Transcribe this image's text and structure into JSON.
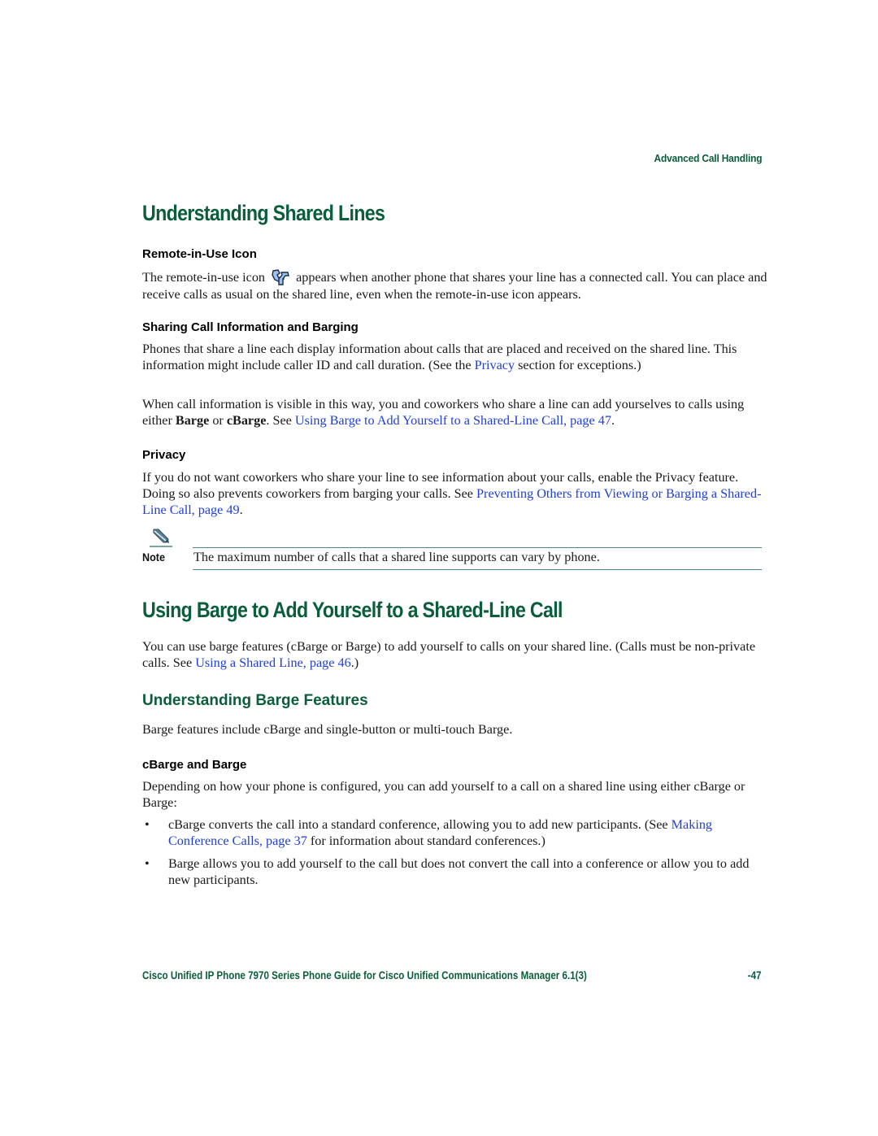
{
  "running_header": "Advanced Call Handling",
  "section1": {
    "title": "Understanding Shared Lines",
    "remote_icon": {
      "heading": "Remote-in-Use Icon",
      "text_before_icon": "The remote-in-use icon",
      "icon": "remote-in-use-phone-icon",
      "text_after_icon": "appears when another phone that shares your line has a connected call. You can place and receive calls as usual on the shared line, even when the remote-in-use icon appears."
    },
    "sharing": {
      "heading": "Sharing Call Information and Barging",
      "para1_before": "Phones that share a line each display information about calls that are placed and received on the shared line. This information might include caller ID and call duration. (See the ",
      "para1_link": "Privacy",
      "para1_after": " section for exceptions.)",
      "para2_before": "When call information is visible in this way, you and coworkers who share a line can add yourselves to calls using either ",
      "para2_bold1": "Barge",
      "para2_mid": " or ",
      "para2_bold2": "cBarge",
      "para2_see": ". See ",
      "para2_link": "Using Barge to Add Yourself to a Shared-Line Call, page 47",
      "para2_end": "."
    },
    "privacy": {
      "heading": "Privacy",
      "text_before": "If you do not want coworkers who share your line to see information about your calls, enable the Privacy feature. Doing so also prevents coworkers from barging your calls. See ",
      "link": "Preventing Others from Viewing or Barging a Shared-Line Call, page 49",
      "text_after": "."
    },
    "note": {
      "label": "Note",
      "icon": "pencil-icon",
      "text": "The maximum number of calls that a shared line supports can vary by phone."
    }
  },
  "section2": {
    "title": "Using Barge to Add Yourself to a Shared-Line Call",
    "intro_before": "You can use barge features (cBarge or Barge) to add yourself to calls on your shared line. (Calls must be non-private calls. See ",
    "intro_link": "Using a Shared Line, page 46",
    "intro_after": ".)",
    "subsection": {
      "title": "Understanding Barge Features",
      "text": "Barge features include cBarge and single-button or multi-touch Barge.",
      "cbarge": {
        "heading": "cBarge and Barge",
        "intro": "Depending on how your phone is configured, you can add yourself to a call on a shared line using either cBarge or Barge:",
        "bullets": [
          {
            "before": "cBarge converts the call into a standard conference, allowing you to add new participants. (See ",
            "link": "Making Conference Calls, page 37",
            "after": " for information about standard conferences.)"
          },
          {
            "before": "Barge allows you to add yourself to the call but does not convert the call into a conference or allow you to add new participants.",
            "link": "",
            "after": ""
          }
        ],
        "bullet_glyph": "•"
      }
    }
  },
  "footer": {
    "title": "Cisco Unified IP Phone 7970 Series Phone Guide for Cisco Unified Communications Manager 6.1(3)",
    "page_number": "-47"
  },
  "colors": {
    "heading_green": "#0b5d3b",
    "link_blue": "#1f3fd6",
    "rule_teal": "#4f8a7c"
  }
}
